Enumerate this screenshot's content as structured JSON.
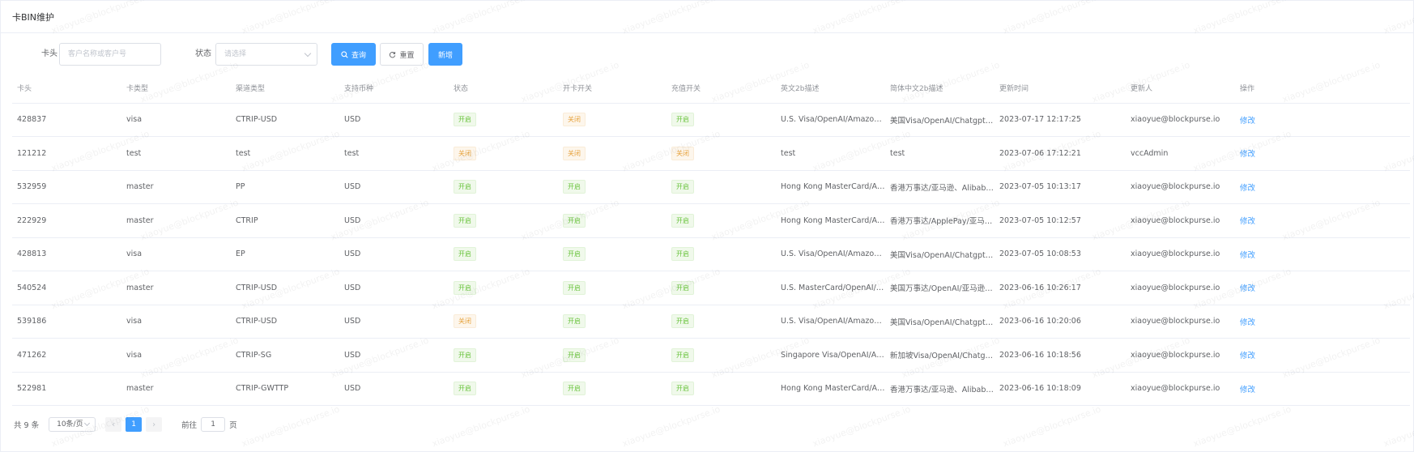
{
  "header": {
    "title": "卡BIN维护"
  },
  "filters": {
    "card_label": "卡头",
    "card_placeholder": "客户名称或客户号",
    "status_label": "状态",
    "status_placeholder": "请选择",
    "query_label": "查询",
    "reset_label": "重置",
    "add_label": "新增"
  },
  "table": {
    "columns": [
      "卡头",
      "卡类型",
      "渠道类型",
      "支持币种",
      "状态",
      "开卡开关",
      "充值开关",
      "英文2b描述",
      "简体中文2b描述",
      "更新时间",
      "更新人",
      "操作"
    ],
    "edit_label": "修改",
    "rows": [
      {
        "bin": "428837",
        "type": "visa",
        "channel": "CTRIP-USD",
        "currency": "USD",
        "status": "开启",
        "open": "关闭",
        "recharge": "开启",
        "en_desc": "U.S. Visa/OpenAI/Amazon, e...",
        "zh_desc": "美国Visa/OpenAI/Chatgpt/亚...",
        "updated": "2023-07-17 12:17:25",
        "updater": "xiaoyue@blockpurse.io"
      },
      {
        "bin": "121212",
        "type": "test",
        "channel": "test",
        "currency": "test",
        "status": "关闭",
        "open": "关闭",
        "recharge": "关闭",
        "en_desc": "test",
        "zh_desc": "test",
        "updated": "2023-07-06 17:12:21",
        "updater": "vccAdmin"
      },
      {
        "bin": "532959",
        "type": "master",
        "channel": "PP",
        "currency": "USD",
        "status": "开启",
        "open": "开启",
        "recharge": "开启",
        "en_desc": "Hong Kong MasterCard/Amaz...",
        "zh_desc": "香港万事达/亚马逊、Alibaba...",
        "updated": "2023-07-05 10:13:17",
        "updater": "xiaoyue@blockpurse.io"
      },
      {
        "bin": "222929",
        "type": "master",
        "channel": "CTRIP",
        "currency": "USD",
        "status": "开启",
        "open": "开启",
        "recharge": "开启",
        "en_desc": "Hong Kong MasterCard/Apple...",
        "zh_desc": "香港万事达/ApplePay/亚马逊...",
        "updated": "2023-07-05 10:12:57",
        "updater": "xiaoyue@blockpurse.io"
      },
      {
        "bin": "428813",
        "type": "visa",
        "channel": "EP",
        "currency": "USD",
        "status": "开启",
        "open": "开启",
        "recharge": "开启",
        "en_desc": "U.S. Visa/OpenAI/Amazon, e...",
        "zh_desc": "美国Visa/OpenAI/Chatgpt/亚...",
        "updated": "2023-07-05 10:08:53",
        "updater": "xiaoyue@blockpurse.io"
      },
      {
        "bin": "540524",
        "type": "master",
        "channel": "CTRIP-USD",
        "currency": "USD",
        "status": "开启",
        "open": "开启",
        "recharge": "开启",
        "en_desc": "U.S. MasterCard/OpenAI/Ama...",
        "zh_desc": "美国万事达/OpenAI/亚马逊、...",
        "updated": "2023-06-16 10:26:17",
        "updater": "xiaoyue@blockpurse.io"
      },
      {
        "bin": "539186",
        "type": "visa",
        "channel": "CTRIP-USD",
        "currency": "USD",
        "status": "关闭",
        "open": "开启",
        "recharge": "开启",
        "en_desc": "U.S. Visa/OpenAI/Amazon, e...",
        "zh_desc": "美国Visa/OpenAI/Chatgpt/亚...",
        "updated": "2023-06-16 10:20:06",
        "updater": "xiaoyue@blockpurse.io"
      },
      {
        "bin": "471262",
        "type": "visa",
        "channel": "CTRIP-SG",
        "currency": "USD",
        "status": "开启",
        "open": "开启",
        "recharge": "开启",
        "en_desc": "Singapore Visa/OpenAI/Amaz...",
        "zh_desc": "新加坡Visa/OpenAI/Chatgpt/...",
        "updated": "2023-06-16 10:18:56",
        "updater": "xiaoyue@blockpurse.io"
      },
      {
        "bin": "522981",
        "type": "master",
        "channel": "CTRIP-GWTTP",
        "currency": "USD",
        "status": "开启",
        "open": "开启",
        "recharge": "开启",
        "en_desc": "Hong Kong MasterCard/Amaz...",
        "zh_desc": "香港万事达/亚马逊、Alibaba...",
        "updated": "2023-06-16 10:18:09",
        "updater": "xiaoyue@blockpurse.io"
      }
    ]
  },
  "pagination": {
    "total": "共 9 条",
    "page_size": "10条/页",
    "current_page": "1",
    "goto_label": "前往",
    "goto_value": "1",
    "page_suffix": "页"
  },
  "watermark": {
    "text": "xiaoyue@blockpurse.io"
  },
  "colors": {
    "primary": "#409eff",
    "success": "#67c23a",
    "warning": "#e6a23c"
  }
}
